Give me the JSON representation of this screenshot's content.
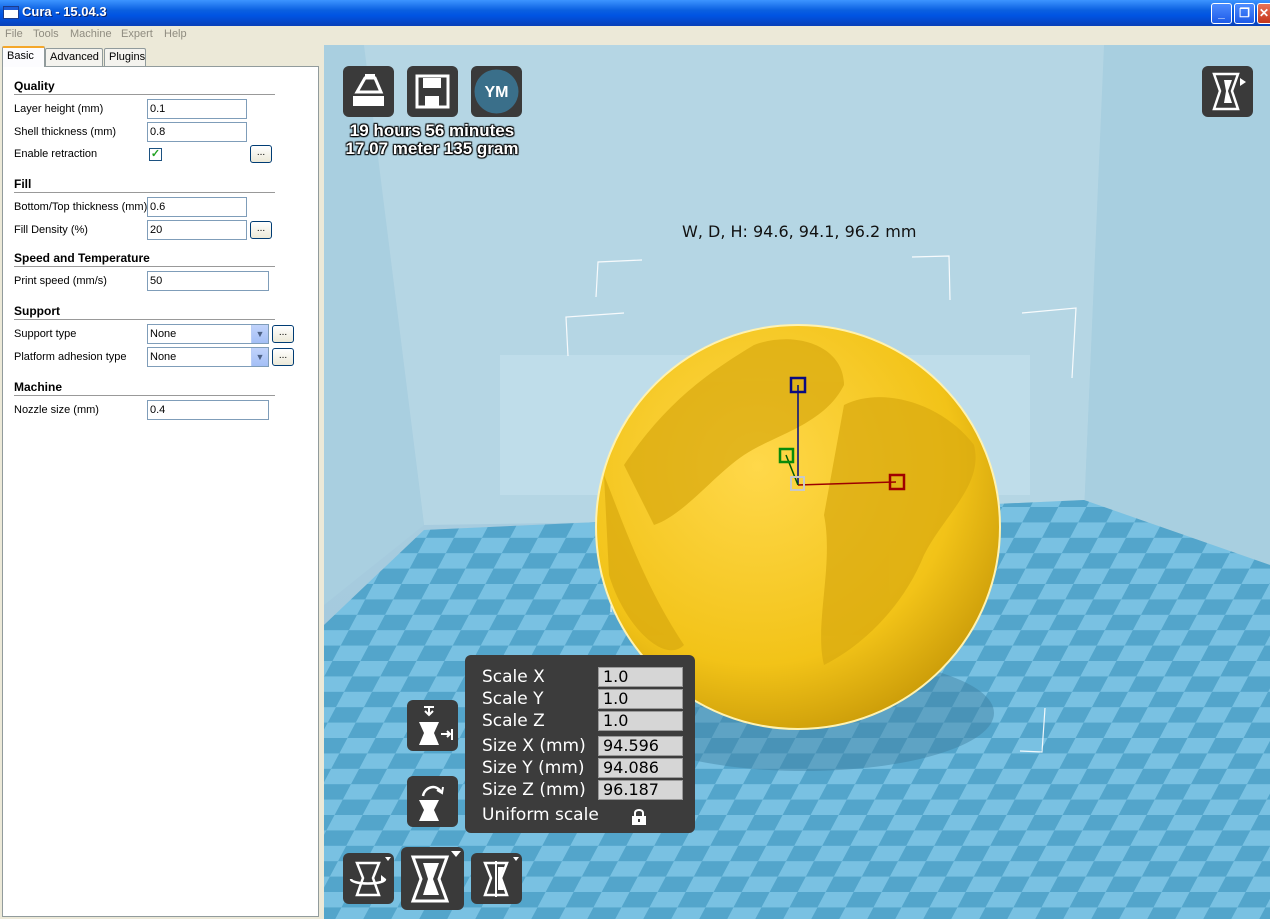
{
  "window": {
    "title": "Cura - 15.04.3"
  },
  "menu": [
    "File",
    "Tools",
    "Machine",
    "Expert",
    "Help"
  ],
  "tabs": [
    "Basic",
    "Advanced",
    "Plugins"
  ],
  "quality": {
    "title": "Quality",
    "layer_height_label": "Layer height (mm)",
    "layer_height": "0.1",
    "shell_thickness_label": "Shell thickness (mm)",
    "shell_thickness": "0.8",
    "retraction_label": "Enable retraction",
    "retraction_checked": true
  },
  "fill": {
    "title": "Fill",
    "bottom_top_label": "Bottom/Top thickness (mm)",
    "bottom_top": "0.6",
    "density_label": "Fill Density (%)",
    "density": "20"
  },
  "speed": {
    "title": "Speed and Temperature",
    "print_speed_label": "Print speed (mm/s)",
    "print_speed": "50"
  },
  "support": {
    "title": "Support",
    "support_type_label": "Support type",
    "support_type": "None",
    "adhesion_label": "Platform adhesion type",
    "adhesion": "None"
  },
  "machine": {
    "title": "Machine",
    "nozzle_label": "Nozzle size (mm)",
    "nozzle": "0.4"
  },
  "more_button": "...",
  "viewport": {
    "print_time": "19 hours 56 minutes",
    "print_material": "17.07 meter 135 gram",
    "ym_label": "YM",
    "dimensions": "W, D, H: 94.6, 94.1, 96.2 mm",
    "model_color": "#f2c318",
    "floor_light": "#7ec5e4",
    "floor_dark": "#4b9fc6"
  },
  "scale_panel": {
    "scale_x_label": "Scale X",
    "scale_x": "1.0",
    "scale_y_label": "Scale Y",
    "scale_y": "1.0",
    "scale_z_label": "Scale Z",
    "scale_z": "1.0",
    "size_x_label": "Size X (mm)",
    "size_x": "94.596",
    "size_y_label": "Size Y (mm)",
    "size_y": "94.086",
    "size_z_label": "Size Z (mm)",
    "size_z": "96.187",
    "uniform_label": "Uniform scale"
  }
}
